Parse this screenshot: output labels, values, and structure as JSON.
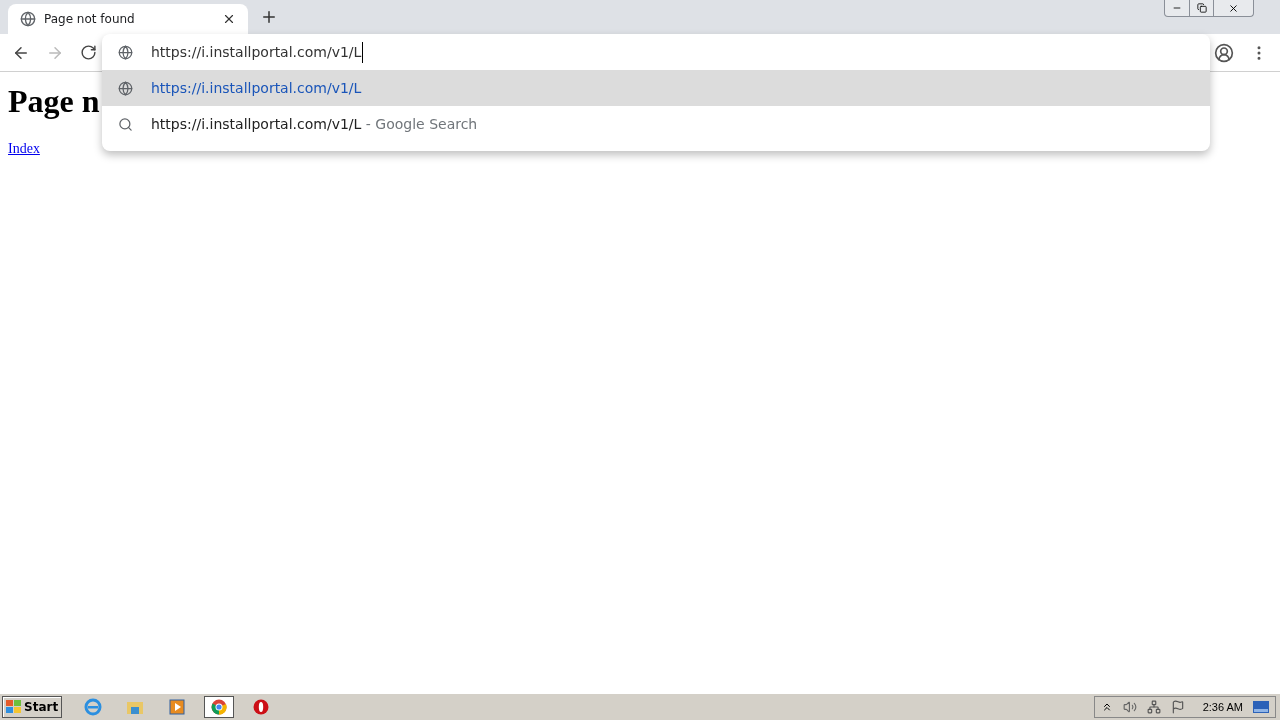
{
  "tab": {
    "title": "Page not found"
  },
  "omnibox": {
    "value": "https://i.installportal.com/v1/L"
  },
  "suggestions": [
    {
      "kind": "url",
      "text": "https://i.installportal.com/v1/L",
      "selected": true
    },
    {
      "kind": "search",
      "text": "https://i.installportal.com/v1/L",
      "description": "- Google Search",
      "selected": false
    }
  ],
  "page": {
    "heading": "Page n",
    "link": "Index"
  },
  "taskbar": {
    "start": "Start",
    "apps": [
      {
        "kind": "ie",
        "selected": false
      },
      {
        "kind": "folder",
        "selected": false
      },
      {
        "kind": "media",
        "selected": false
      },
      {
        "kind": "chrome",
        "selected": true
      },
      {
        "kind": "opera",
        "selected": false
      }
    ],
    "clock": "2:36 AM"
  }
}
